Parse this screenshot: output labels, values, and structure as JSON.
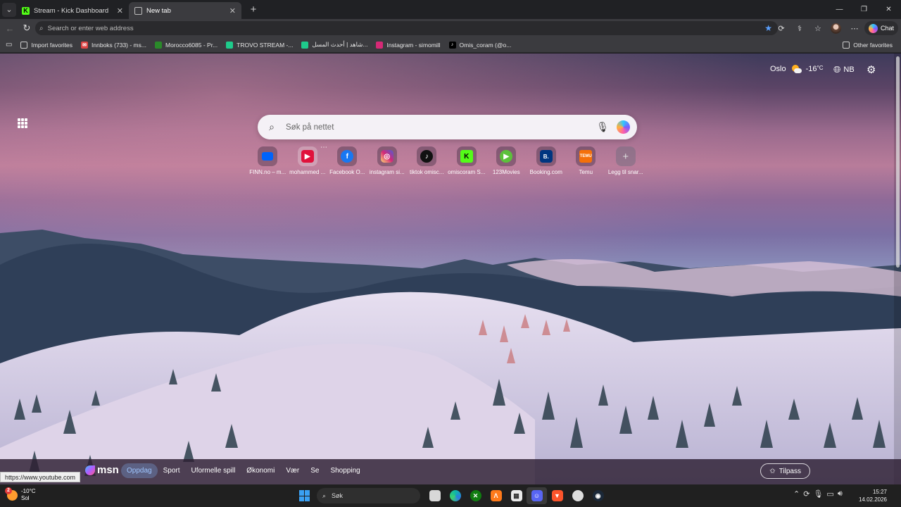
{
  "browser": {
    "tabs": [
      {
        "title": "Stream - Kick Dashboard",
        "active": false
      },
      {
        "title": "New tab",
        "active": true
      }
    ],
    "address": {
      "placeholder": "Search or enter web address"
    },
    "chat_label": "Chat"
  },
  "favorites": {
    "items": [
      {
        "label": "Import favorites",
        "icon": "folder-import-icon"
      },
      {
        "label": "Innboks (733) - ms...",
        "icon": "mail-icon"
      },
      {
        "label": "Morocco6085 - Pr...",
        "icon": "kick-icon"
      },
      {
        "label": "TROVO STREAM -...",
        "icon": "trovo-icon"
      },
      {
        "label": "شاهد | أحدث المسل...",
        "icon": "shahid-icon"
      },
      {
        "label": "Instagram - simomill",
        "icon": "instagram-icon"
      },
      {
        "label": "Omis_coram (@o...",
        "icon": "tiktok-icon"
      }
    ],
    "other": "Other favorites"
  },
  "newtab": {
    "weather": {
      "city": "Oslo",
      "temp": "-16",
      "unit": "°C"
    },
    "language": "NB",
    "search_placeholder": "Søk på nettet",
    "quick_links": [
      {
        "label": "FINN.no – m...",
        "icon": "finn-icon",
        "color": "#0063fb"
      },
      {
        "label": "mohammed ...",
        "icon": "youtube-icon",
        "color": "#e0113b"
      },
      {
        "label": "Facebook O...",
        "icon": "facebook-icon",
        "color": "#1877f2"
      },
      {
        "label": "instagram si...",
        "icon": "instagram-icon",
        "color": "#d62976"
      },
      {
        "label": "tiktok omisc...",
        "icon": "tiktok-icon",
        "color": "#111111"
      },
      {
        "label": "omiscoram S...",
        "icon": "kick-icon",
        "color": "#53fc18"
      },
      {
        "label": "123Movies",
        "icon": "play-icon",
        "color": "#5cc13b"
      },
      {
        "label": "Booking.com",
        "icon": "booking-icon",
        "color": "#003580"
      },
      {
        "label": "Temu",
        "icon": "temu-icon",
        "color": "#f5700a"
      },
      {
        "label": "Legg til snar...",
        "icon": "plus-icon",
        "color": "#666666"
      }
    ]
  },
  "msn": {
    "logo": "msn",
    "nav": [
      "Oppdag",
      "Sport",
      "Uformelle spill",
      "Økonomi",
      "Vær",
      "Se",
      "Shopping"
    ],
    "selected": "Oppdag",
    "customize": "Tilpass"
  },
  "status_url": "https://www.youtube.com",
  "taskbar": {
    "weather": {
      "temp": "-10°C",
      "cond": "Sol",
      "badge": "2"
    },
    "search": "Søk",
    "time": "15:27",
    "date": "14.02.2026"
  }
}
